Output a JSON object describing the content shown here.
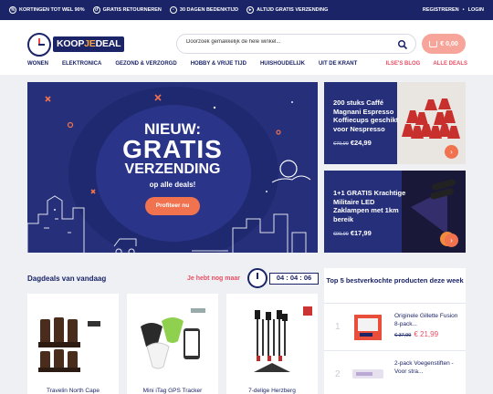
{
  "topbar": {
    "perks": [
      {
        "icon": "percent-icon",
        "label": "KORTINGEN TOT WEL 90%"
      },
      {
        "icon": "return-icon",
        "label": "GRATIS RETOURNEREN"
      },
      {
        "icon": "calendar-icon",
        "label": "30 DAGEN BEDENKTIJD"
      },
      {
        "icon": "truck-icon",
        "label": "ALTIJD GRATIS VERZENDING"
      }
    ],
    "register": "REGISTREREN",
    "separator": "•",
    "login": "LOGIN"
  },
  "logo": {
    "part1": "KOOP",
    "part2": "JE",
    "part3": "DEAL"
  },
  "search": {
    "placeholder": "Doorzoek gemakkelijk de hele winkel..."
  },
  "cart": {
    "label": "€ 0,00"
  },
  "nav": {
    "items": [
      "WONEN",
      "ELEKTRONICA",
      "GEZOND & VERZORGD",
      "HOBBY & VRIJE TIJD",
      "HUISHOUDELIJK",
      "UIT DE KRANT"
    ],
    "right": [
      "ILSE'S BLOG",
      "ALLE DEALS"
    ]
  },
  "hero": {
    "line1": "NIEUW:",
    "line2": "GRATIS",
    "line3": "VERZENDING",
    "line4": "op alle deals!",
    "cta": "Profiteer nu"
  },
  "promos": [
    {
      "title": "200 stuks Caffé Magnani Espresso Koffiecups geschikt voor Nespresso",
      "old_price": "€79,99",
      "price": "€24,99"
    },
    {
      "title": "1+1 GRATIS Krachtige Militaire LED Zaklampen met 1km bereik",
      "old_price": "€99,99",
      "price": "€17,99"
    }
  ],
  "deals": {
    "title": "Dagdeals van vandaag",
    "timer_label": "Je hebt nog maar",
    "timer": "04 : 04 : 06",
    "products": [
      {
        "name": "Travelin North Cape"
      },
      {
        "name": "Mini iTag GPS Tracker"
      },
      {
        "name": "7-delige Herzberg"
      }
    ]
  },
  "top5": {
    "title": "Top 5 bestverkochte producten deze week",
    "items": [
      {
        "rank": "1",
        "name": "Originele Gillette Fusion 8-pack...",
        "old_price": "€ 37,99",
        "price": "€ 21,99"
      },
      {
        "rank": "2",
        "name": "2-pack Voegenstiften - Voor stra..."
      }
    ]
  },
  "colors": {
    "navy": "#1b2466",
    "hero": "#26307a",
    "accent": "#f0724f",
    "pink": "#e94e63"
  }
}
